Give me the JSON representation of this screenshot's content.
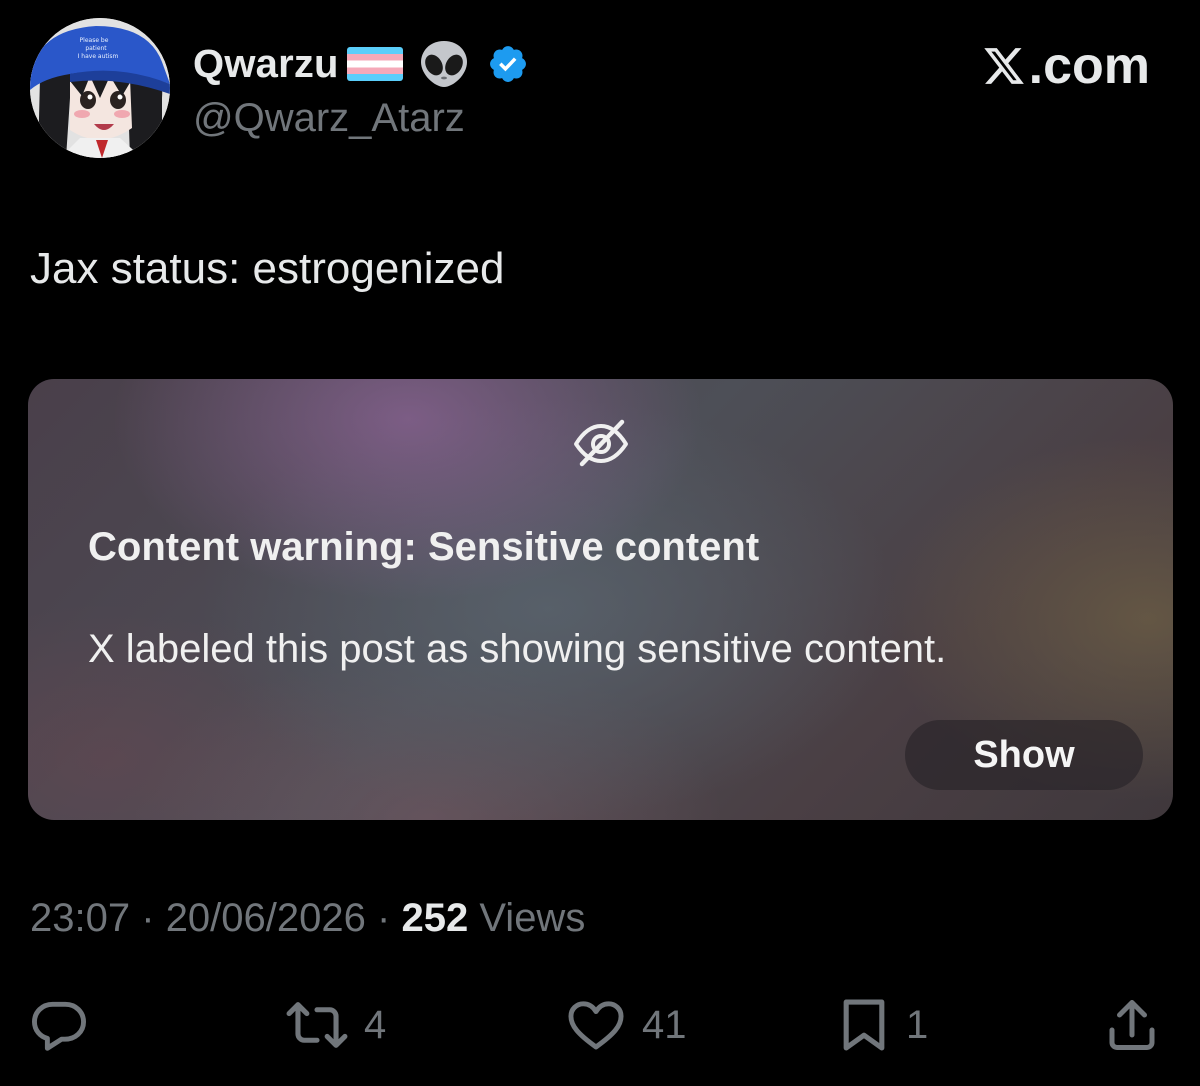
{
  "author": {
    "display_name": "Qwarzu",
    "flag_emoji": "🏳️‍⚧️",
    "alien_emoji": "👽",
    "handle": "@Qwarz_Atarz",
    "verified": true,
    "avatar_cap_text": "Please be patient I have autism"
  },
  "brand": {
    "label": ".com",
    "logo": "x-logo-icon"
  },
  "tweet": {
    "text": "Jax status: estrogenized"
  },
  "warning": {
    "icon": "eye-slash-icon",
    "title": "Content warning: Sensitive content",
    "body": "X labeled this post as showing sensitive content.",
    "show_label": "Show"
  },
  "meta": {
    "time": "23:07",
    "separator": "·",
    "date": "20/06/2026",
    "views_count": "252",
    "views_label": "Views"
  },
  "actions": {
    "reply_count": "",
    "retweet_count": "4",
    "like_count": "41",
    "bookmark_count": "1"
  },
  "colors": {
    "background": "#000000",
    "text": "#e7e9ea",
    "muted": "#71767b",
    "verified_blue": "#1d9bf0"
  }
}
